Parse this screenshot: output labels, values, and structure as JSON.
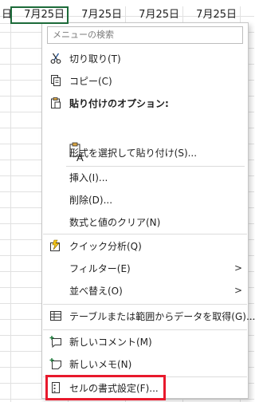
{
  "sheet": {
    "cells": [
      "日",
      "7月25日",
      "7月25日",
      "7月25日",
      "7月25日"
    ]
  },
  "menu": {
    "search_placeholder": "メニューの検索",
    "cut": "切り取り(T)",
    "copy": "コピー(C)",
    "paste_options": "貼り付けのオプション:",
    "paste_special": "形式を選択して貼り付け(S)...",
    "insert": "挿入(I)...",
    "delete": "削除(D)...",
    "clear": "数式と値のクリア(N)",
    "quick_analysis": "クイック分析(Q)",
    "filter": "フィルター(E)",
    "sort": "並べ替え(O)",
    "get_data": "テーブルまたは範囲からデータを取得(G)...",
    "new_comment": "新しいコメント(M)",
    "new_note": "新しいメモ(N)",
    "format_cells": "セルの書式設定(F)...",
    "submenu_arrow": ">"
  },
  "colors": {
    "active_cell_border": "#1d6b3a",
    "highlight_box": "#e8192c"
  }
}
